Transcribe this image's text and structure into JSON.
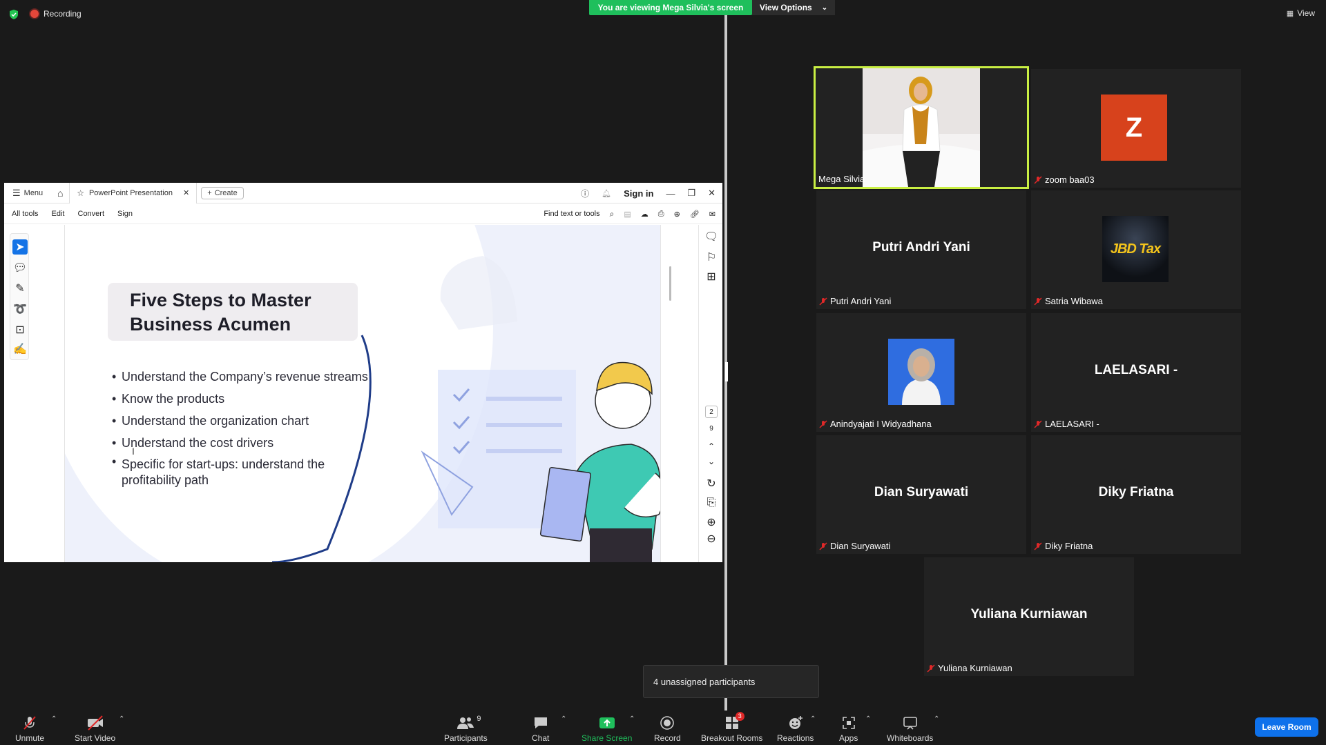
{
  "top": {
    "recording": "Recording",
    "viewing_banner": "You are viewing Mega Silvia's screen",
    "view_options": "View Options",
    "view": "View"
  },
  "share": {
    "menu": "Menu",
    "tab_title": "PowerPoint Presentation",
    "create": "Create",
    "sign_in": "Sign in",
    "menubar": [
      "All tools",
      "Edit",
      "Convert",
      "Sign"
    ],
    "find_placeholder": "Find text or tools",
    "page_current": "2",
    "page_total": "9"
  },
  "slide": {
    "title_line1": "Five Steps to Master",
    "title_line2": "Business Acumen",
    "bullets": [
      "Understand the Company’s revenue streams",
      "Know the products",
      "Understand the organization chart",
      "Understand the cost drivers",
      "Specific for start-ups: understand the profitability path"
    ]
  },
  "gallery": {
    "tiles": [
      {
        "name": "Mega Silvia"
      },
      {
        "name": "zoom baa03",
        "avatar_letter": "Z"
      },
      {
        "name": "Putri Andri Yani",
        "big": "Putri Andri Yani"
      },
      {
        "name": "Satria Wibawa",
        "logo_text": "JBD Tax"
      },
      {
        "name": "Anindyajati I Widyadhana"
      },
      {
        "name": "LAELASARI -",
        "big": "LAELASARI -"
      },
      {
        "name": "Dian Suryawati",
        "big": "Dian Suryawati"
      },
      {
        "name": "Diky Friatna",
        "big": "Diky Friatna"
      },
      {
        "name": "Yuliana Kurniawan",
        "big": "Yuliana Kurniawan"
      }
    ]
  },
  "unassigned": "4 unassigned participants",
  "toolbar": {
    "unmute": "Unmute",
    "start_video": "Start Video",
    "participants": "Participants",
    "participants_count": "9",
    "chat": "Chat",
    "share_screen": "Share Screen",
    "record": "Record",
    "breakout_rooms": "Breakout Rooms",
    "breakout_badge": "3",
    "reactions": "Reactions",
    "apps": "Apps",
    "whiteboards": "Whiteboards",
    "leave": "Leave Room"
  },
  "colors": {
    "active_speaker": "#c9ef43",
    "viewing_banner": "#1fbf5c",
    "share_green": "#1fbf5c",
    "leave_blue": "#0e71eb",
    "mute_red": "#e02828"
  }
}
